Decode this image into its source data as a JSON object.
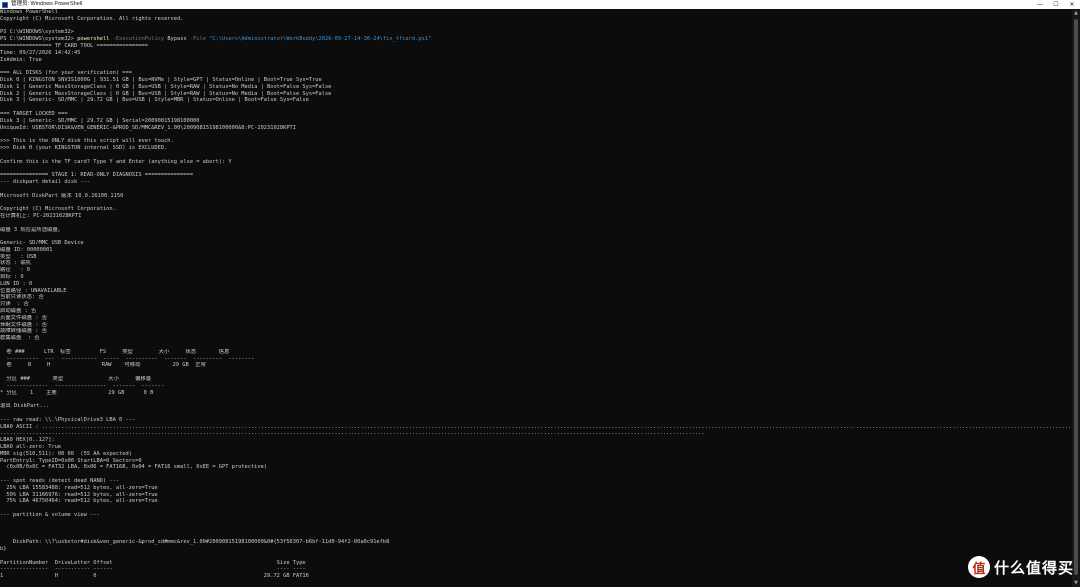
{
  "window": {
    "title": "管理员: Windows PowerShell",
    "controls": {
      "minimize": "—",
      "maximize": "☐",
      "close": "✕"
    },
    "icon": "powershell-icon"
  },
  "command": {
    "prompt": "PS C:\\WINDOWS\\system32> ",
    "exe": "powershell",
    "param1": " -ExecutionPolicy",
    "arg1": " Bypass",
    "param2": " -File",
    "path": " \"C:\\Users\\Administrator\\WorkBuddy\\2026-09-27-14-36-24\\fix_tfcard.ps1\""
  },
  "lines": [
    "Windows PowerShell",
    "Copyright (C) Microsoft Corporation. All rights reserved.",
    "",
    "PS C:\\WINDOWS\\system32>",
    "",
    "================ TF CARD TOOL ================",
    "Time: 09/27/2026 14:42:45",
    "IsAdmin: True",
    "",
    "=== ALL DISKS (for your verification) ===",
    "Disk 0 | KINGSTON SNV3S1000G | 931.51 GB | Bus=NVMe | Style=GPT | Status=Online | Boot=True Sys=True",
    "Disk 1 | Generic MassStorageClass | 0 GB | Bus=USB | Style=RAW | Status=No Media | Boot=False Sys=False",
    "Disk 2 | Generic MassStorageClass | 0 GB | Bus=USB | Style=RAW | Status=No Media | Boot=False Sys=False",
    "Disk 3 | Generic- SD/MMC | 29.72 GB | Bus=USB | Style=MBR | Status=Online | Boot=False Sys=False",
    "",
    "=== TARGET LOCKED ===",
    "Disk 3 | Generic- SD/MMC | 29.72 GB | Serial=20090815198100000",
    "UniqueId: USBSTOR\\DISK&VEN_GENERIC-&PROD_SD/MMC&REV_1.00\\20090815198100000&0:PC-20231028KPTI",
    "",
    ">>> This is the ONLY disk this script will ever touch.",
    ">>> Disk 0 (your KINGSTON internal SSD) is EXCLUDED.",
    "",
    "Confirm this is the TF card? Type Y and Enter (anything else = abort): Y",
    "",
    "=============== STAGE 1: READ-ONLY DIAGNOSIS ===============",
    "--- diskpart detail disk ---",
    "",
    "Microsoft DiskPart 版本 10.0.26100.1150",
    "",
    "Copyright (C) Microsoft Corporation.",
    "在计算机上: PC-20231028KPTI",
    "",
    "磁盘 3 现在是所选磁盘。",
    "",
    "Generic- SD/MMC USB Device",
    "磁盘 ID: 00000001",
    "类型   : USB",
    "状态 : 联机",
    "路径   : 0",
    "目标 : 0",
    "LUN ID : 0",
    "位置路径 : UNAVAILABLE",
    "当前只读状态: 否",
    "只读  : 否",
    "启动磁盘 : 否",
    "页面文件磁盘 : 否",
    "休眠文件磁盘 : 否",
    "故障转储磁盘 : 否",
    "群集磁盘  : 否",
    "",
    "  卷 ###      LTR  标签         FS     类型        大小     状态       信息",
    "  ----------  ---  -----------  -----  ----------  -------  ---------  --------",
    "  卷     8     H                RAW    可移动          29 GB  正常",
    "",
    "  分区 ###       类型              大小     偏移量",
    "  -------------  ----------------  -------  -------",
    "* 分区    1    主要                29 GB      0 B",
    "",
    "退出 DiskPart...",
    "",
    "--- raw read: \\\\.\\PhysicalDrive3 LBA 0 ---",
    "LBA0 ASCII : ............................................................................................................................................................................................................................................................................................................................................",
    "...........................................................................................................................................................................................................................",
    "LBA0 HEX[0..127]:",
    "LBA0 all-zero: True",
    "MBR sig(510,511): 00 00  (55 AA expected)",
    "PartEntry1: TypeID=0x00 StartLBA=0 Sectors=0",
    "  (0x0B/0x0C = FAT32 LBA, 0x06 = FAT16B, 0x04 = FAT16 small, 0xEE = GPT protective)",
    "",
    "--- spot reads (detect dead NAND) ---",
    "  25% LBA 15583488: read=512 bytes, all-zero=True",
    "  50% LBA 31166976: read=512 bytes, all-zero=True",
    "  75% LBA 46750464: read=512 bytes, all-zero=True",
    "",
    "--- partition & volume view ---",
    "",
    "",
    "",
    "    DiskPath: \\\\?\\usbstor#disk&ven_generic-&prod_sd#mmc&rev_1.00#20090815198100000&0#{53f56307-b6bf-11d0-94f2-00a0c91efb8",
    "b}",
    "",
    "PartitionNumber  DriveLetter Offset                                                   Size Type",
    "---------------  ----------- ------                                                   ---- ----",
    "1                H           0                                                    29.72 GB FAT16"
  ],
  "watermark": {
    "badge": "值",
    "text": "什么值得买"
  }
}
